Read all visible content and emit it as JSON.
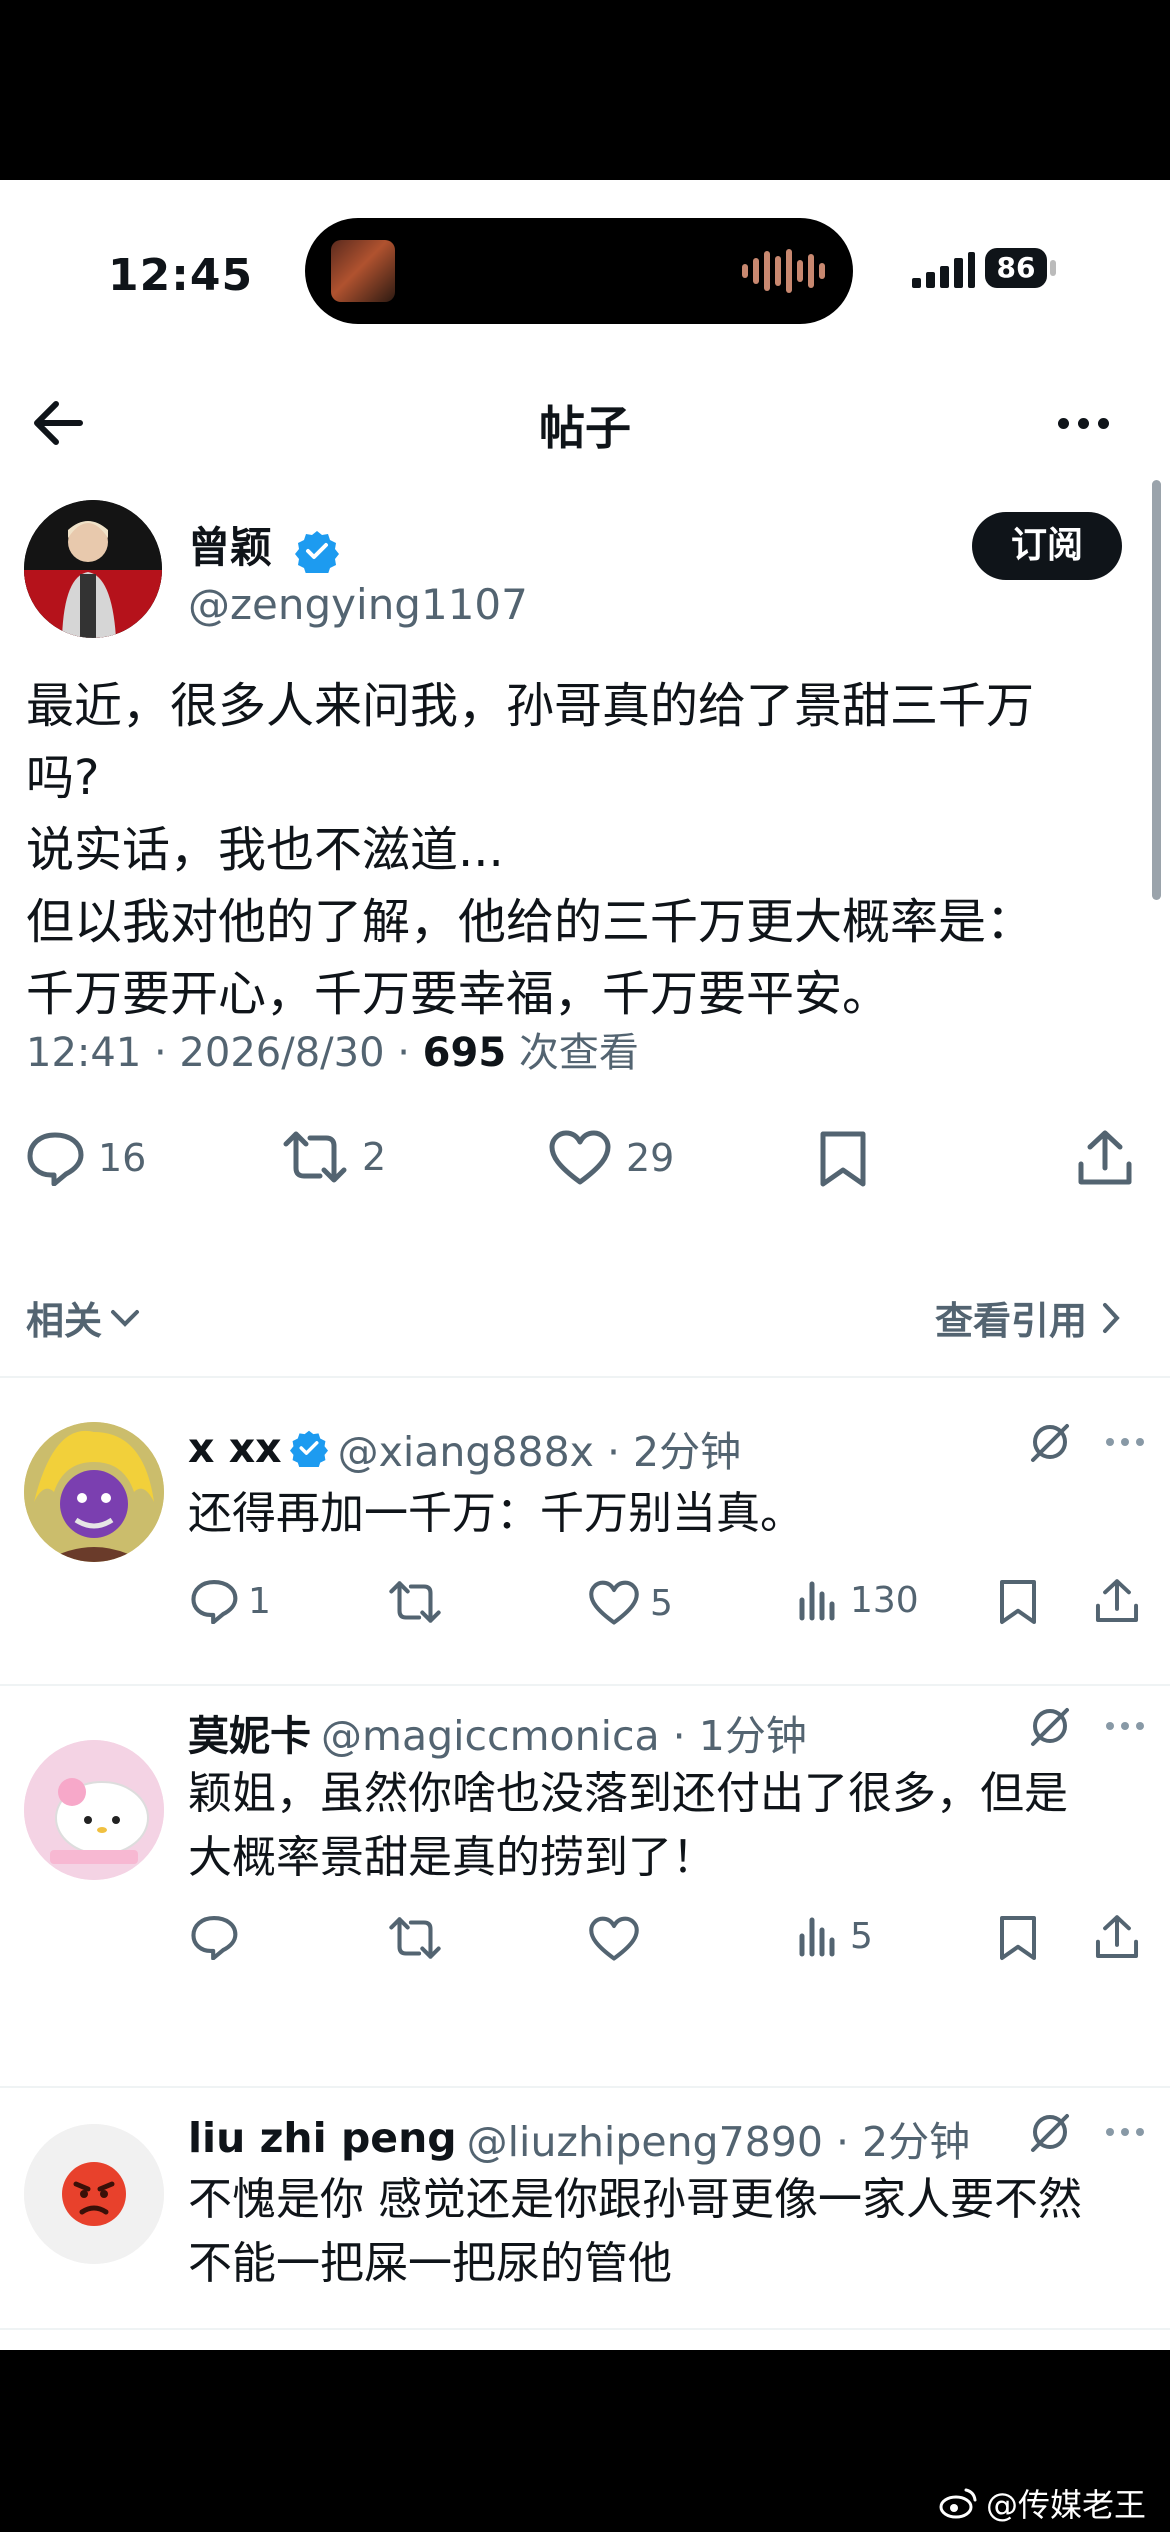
{
  "status_bar": {
    "time": "12:45",
    "battery": "86"
  },
  "nav": {
    "title": "帖子"
  },
  "post": {
    "author_name": "曾颖",
    "handle": "@zengying1107",
    "subscribe_label": "订阅",
    "text": "最近，很多人来问我，孙哥真的给了景甜三千万\n吗?\n说实话，我也不滋道...\n但以我对他的了解，他给的三千万更大概率是：\n千万要开心，千万要幸福，千万要平安。",
    "time_date": "12:41 · 2026/8/30 · ",
    "views_count": "695",
    "views_label": " 次查看",
    "stats": {
      "replies": "16",
      "reposts": "2",
      "likes": "29"
    }
  },
  "related": {
    "label": "相关",
    "view_quotes_label": "查看引用"
  },
  "replies": [
    {
      "name": "x xx",
      "handle": "@xiang888x · 2分钟",
      "text": "还得再加一千万：千万别当真。",
      "replies": "1",
      "reposts": "",
      "likes": "5",
      "views": "130"
    },
    {
      "name": "莫妮卡",
      "handle": "@magiccmonica · 1分钟",
      "text": "颖姐，虽然你啥也没落到还付出了很多，但是\n大概率景甜是真的捞到了！",
      "replies": "",
      "reposts": "",
      "likes": "",
      "views": "5"
    },
    {
      "name": "liu zhi peng",
      "handle": "@liuzhipeng7890 · 2分钟",
      "text": "不愧是你 感觉还是你跟孙哥更像一家人要不然\n不能一把屎一把尿的管他"
    }
  ],
  "watermark": "@传媒老王",
  "colors": {
    "text": "#0f1419",
    "secondary": "#536471",
    "verified": "#1d9bf0",
    "divider": "#eff3f4"
  },
  "icons": [
    "back-arrow-icon",
    "more-icon",
    "verified-icon",
    "reply-icon",
    "repost-icon",
    "like-icon",
    "bookmark-icon",
    "share-icon",
    "views-icon",
    "grok-icon",
    "chevron-down-icon",
    "chevron-right-icon",
    "weibo-icon"
  ]
}
